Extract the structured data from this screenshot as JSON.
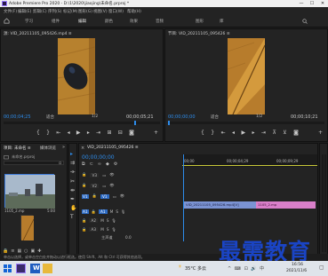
{
  "titlebar": {
    "title": "Adobe Premiere Pro 2020 - D:\\1\\2020\\jiaojing\\未命名.prproj *",
    "minimize": "—",
    "maximize": "☐",
    "close": "✕"
  },
  "menu": [
    "文件(F)",
    "编辑(E)",
    "剪辑(C)",
    "序列(S)",
    "标记(M)",
    "图形(G)",
    "视图(V)",
    "窗口(W)",
    "帮助(H)"
  ],
  "workspaces": [
    "学习",
    "组件",
    "编辑",
    "颜色",
    "效果",
    "音频",
    "图形",
    "库"
  ],
  "source": {
    "title": "源: VID_20211105_095426.mp4 ≡",
    "timecode_left": "00;00;04;25",
    "fit": "适合",
    "ratio": "1/2",
    "timecode_right": "00;00;05;21"
  },
  "program": {
    "title": "节目: VID_20211105_095426 ≡",
    "timecode_left": "00;00;00;00",
    "fit": "适合",
    "ratio": "1/2",
    "timecode_right": "00;00;10;21"
  },
  "project": {
    "tabs": [
      "项目: 未命名 ≡",
      "媒体浏览"
    ],
    "file_label": "未命名.prproj",
    "clip_name": "1105_2.mp",
    "clip_duration": "5:00"
  },
  "timeline": {
    "tab_close": "×",
    "title": "VID_20211105_095426 ≡",
    "timecode": "00;00;00;00",
    "ruler": [
      "00;00",
      "00;00;04;29",
      "00;00;09;29"
    ],
    "video_tracks": [
      "V3",
      "V2",
      "V1"
    ],
    "audio_tracks": [
      "A1",
      "A2",
      "A3"
    ],
    "master_label": "主声道",
    "master_value": "0.0",
    "clip1_label": "VID_20211105_095426.mp4[V]",
    "clip2_label": "1105_2.mp"
  },
  "status": "单击以选择，或单击空白处并拖动以进行框选。使用 Shift、Alt 和 Ctrl 可获得其他选项。",
  "taskbar": {
    "temperature": "35°C 多云",
    "time": "16:56",
    "date": "2021/11/6"
  },
  "watermark": "最需教育",
  "colors": {
    "accent_blue": "#2d8ceb",
    "clip_video": "#7b93d3",
    "clip_pink": "#d97fc9",
    "playhead": "#2d8ceb"
  }
}
